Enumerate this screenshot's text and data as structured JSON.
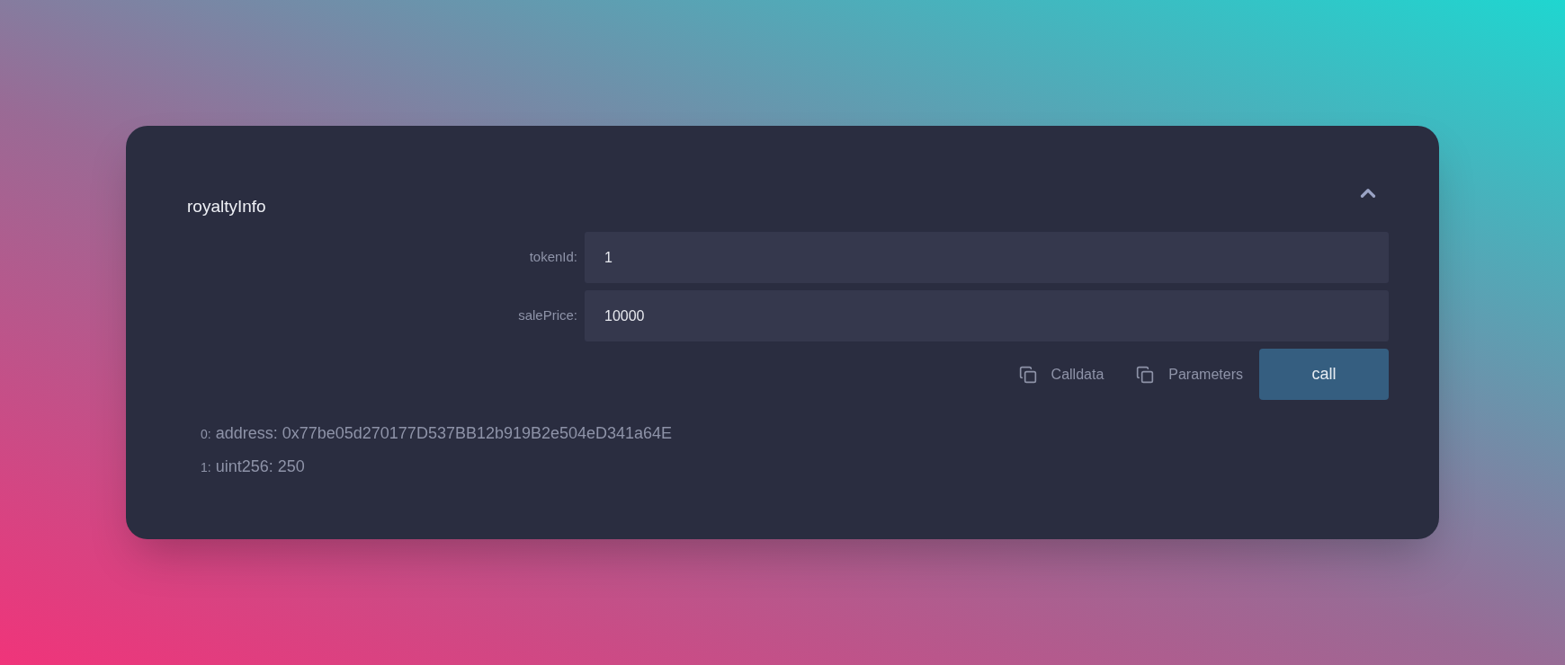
{
  "function": {
    "name": "royaltyInfo",
    "expanded": true
  },
  "inputs": [
    {
      "label": "tokenId:",
      "value": "1"
    },
    {
      "label": "salePrice:",
      "value": "10000"
    }
  ],
  "actions": [
    {
      "label": "Calldata"
    },
    {
      "label": "Parameters"
    }
  ],
  "call_button": "call",
  "outputs": [
    {
      "index": "0:",
      "text": "address: 0x77be05d270177D537BB12b919B2e504eD341a64E"
    },
    {
      "index": "1:",
      "text": "uint256: 250"
    }
  ]
}
